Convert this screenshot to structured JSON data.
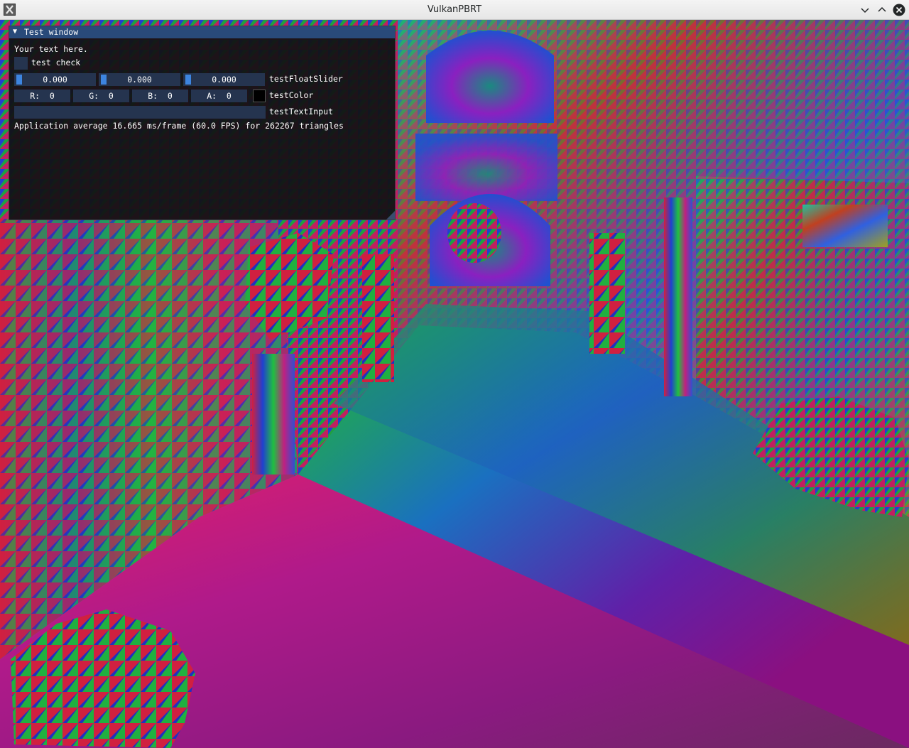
{
  "window": {
    "title": "VulkanPBRT",
    "app_icon": "x11-app-icon",
    "controls": [
      "minimize-icon",
      "maximize-icon",
      "close-icon"
    ]
  },
  "imgui": {
    "title": "Test window",
    "collapse_arrow": "▼",
    "text": "Your text here.",
    "checkbox": {
      "label": "test check",
      "checked": false
    },
    "float_slider": {
      "label": "testFloatSlider",
      "values": [
        "0.000",
        "0.000",
        "0.000"
      ]
    },
    "color": {
      "label": "testColor",
      "fields": [
        "R:  0",
        "G:  0",
        "B:  0",
        "A:  0"
      ],
      "swatch": "#000000"
    },
    "text_input": {
      "label": "testTextInput",
      "value": ""
    },
    "stats": "Application average 16.665 ms/frame (60.0 FPS) for 262267 triangles"
  },
  "colors": {
    "imgui_title": "#294a7a",
    "imgui_frame": "#25344f",
    "imgui_accent": "#3d85e0"
  }
}
